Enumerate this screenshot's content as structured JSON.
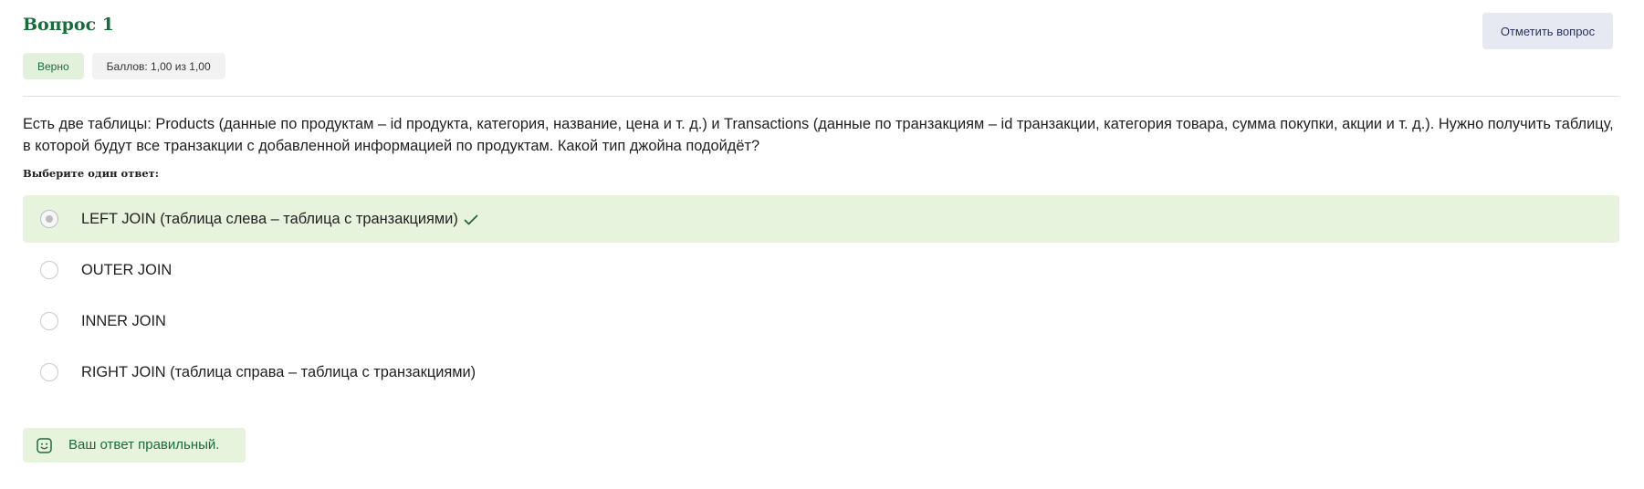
{
  "question": {
    "title": "Вопрос 1",
    "status_badge": "Верно",
    "score_badge": "Баллов: 1,00 из 1,00",
    "flag_button": "Отметить вопрос",
    "text": "Есть две таблицы: Products (данные по продуктам – id продукта, категория, название, цена и т. д.) и Transactions (данные по транзакциям – id транзакции, категория товара, сумма покупки, акции и т. д.). Нужно получить таблицу, в которой будут все транзакции с добавленной информацией по продуктам. Какой тип джойна подойдёт?",
    "prompt": "Выберите один ответ:"
  },
  "answers": [
    {
      "label": "LEFT JOIN (таблица слева – таблица с транзакциями)",
      "selected": true,
      "correct": true
    },
    {
      "label": "OUTER JOIN",
      "selected": false,
      "correct": false
    },
    {
      "label": "INNER JOIN",
      "selected": false,
      "correct": false
    },
    {
      "label": "RIGHT JOIN (таблица справа – таблица с транзакциями)",
      "selected": false,
      "correct": false
    }
  ],
  "feedback": {
    "text": "Ваш ответ правильный.",
    "icon": "smile-icon"
  },
  "colors": {
    "accent_green": "#1a6b3c",
    "correct_bg": "#e8f3de",
    "flag_bg": "#e6e8f2"
  }
}
